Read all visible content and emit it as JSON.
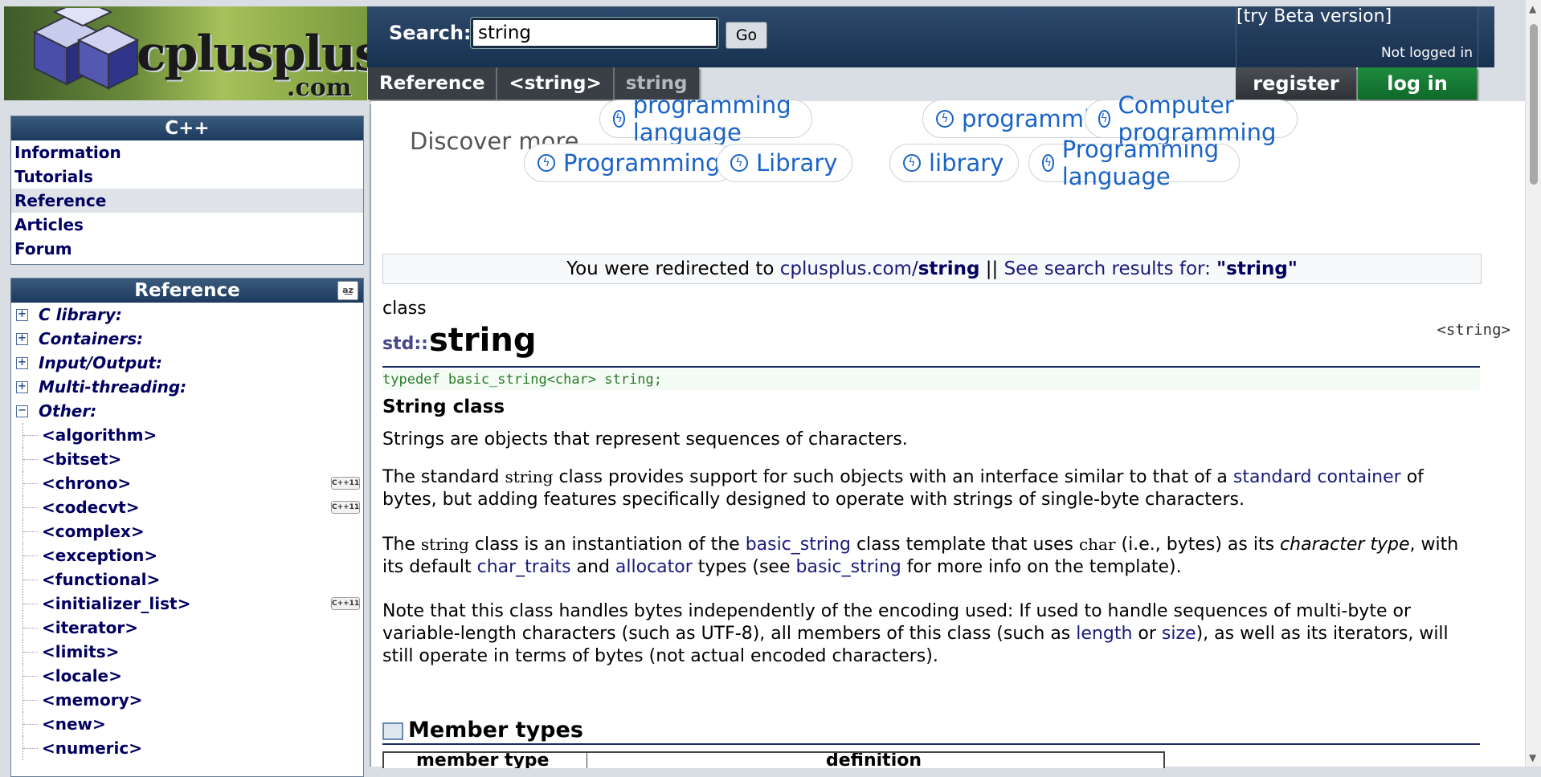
{
  "header": {
    "logo_text": "cplusplus",
    "logo_domain": ".com",
    "search_label": "Search:",
    "search_value": "string",
    "go_label": "Go",
    "beta_link": "[try Beta version]",
    "login_status": "Not logged in",
    "breadcrumb": [
      "Reference",
      "<string>",
      "string"
    ],
    "register": "register",
    "login": "log in"
  },
  "sidebar": {
    "cpp_title": "C++",
    "cpp_links": [
      "Information",
      "Tutorials",
      "Reference",
      "Articles",
      "Forum"
    ],
    "active_link": "Reference",
    "ref_title": "Reference",
    "categories": [
      {
        "label": "C library:",
        "toggle": "+"
      },
      {
        "label": "Containers:",
        "toggle": "+"
      },
      {
        "label": "Input/Output:",
        "toggle": "+"
      },
      {
        "label": "Multi-threading:",
        "toggle": "+"
      },
      {
        "label": "Other:",
        "toggle": "−"
      }
    ],
    "headers": [
      {
        "label": "<algorithm>",
        "badge": ""
      },
      {
        "label": "<bitset>",
        "badge": ""
      },
      {
        "label": "<chrono>",
        "badge": "C++11"
      },
      {
        "label": "<codecvt>",
        "badge": "C++11"
      },
      {
        "label": "<complex>",
        "badge": ""
      },
      {
        "label": "<exception>",
        "badge": ""
      },
      {
        "label": "<functional>",
        "badge": ""
      },
      {
        "label": "<initializer_list>",
        "badge": "C++11"
      },
      {
        "label": "<iterator>",
        "badge": ""
      },
      {
        "label": "<limits>",
        "badge": ""
      },
      {
        "label": "<locale>",
        "badge": ""
      },
      {
        "label": "<memory>",
        "badge": ""
      },
      {
        "label": "<new>",
        "badge": ""
      },
      {
        "label": "<numeric>",
        "badge": ""
      }
    ]
  },
  "discover": {
    "label": "Discover more",
    "pills": [
      "programming language",
      "programming",
      "Computer programming",
      "Programming",
      "Library",
      "library",
      "Programming language"
    ]
  },
  "redirect": {
    "prefix": "You were redirected to",
    "site": "cplusplus.com/",
    "page": "string",
    "separator": "||",
    "search_text": "See search results for:",
    "query": "\"string\""
  },
  "article": {
    "kind": "class",
    "namespace": "std::",
    "name": "string",
    "header": "<string>",
    "typedef": "typedef basic_string<char> string;",
    "short_desc": "String class",
    "p1": "Strings are objects that represent sequences of characters.",
    "p2": {
      "a": "The standard ",
      "code": "string",
      "b": " class provides support for such objects with an interface similar to that of a ",
      "link": "standard container",
      "c": " of bytes, but adding features specifically designed to operate with strings of single-byte characters."
    },
    "p3": {
      "a": "The ",
      "code1": "string",
      "b": " class is an instantiation of the ",
      "link1": "basic_string",
      "c": " class template that uses ",
      "code2": "char",
      "d": " (i.e., bytes) as its ",
      "em": "character type",
      "e": ", with its default ",
      "link2": "char_traits",
      "f": " and ",
      "link3": "allocator",
      "g": " types (see ",
      "link4": "basic_string",
      "h": " for more info on the template)."
    },
    "p4": {
      "a": "Note that this class handles bytes independently of the encoding used: If used to handle sequences of multi-byte or variable-length characters (such as UTF-8), all members of this class (such as ",
      "link1": "length",
      "b": " or ",
      "link2": "size",
      "c": "), as well as its iterators, will still operate in terms of bytes (not actual encoded characters)."
    },
    "member_types_heading": "Member types",
    "table_headers": [
      "member type",
      "definition"
    ]
  },
  "colors": {
    "header_blue": "#1f3a5c",
    "login_green": "#137a35",
    "link_blue": "#1a63c6",
    "nav_text": "#000060"
  }
}
